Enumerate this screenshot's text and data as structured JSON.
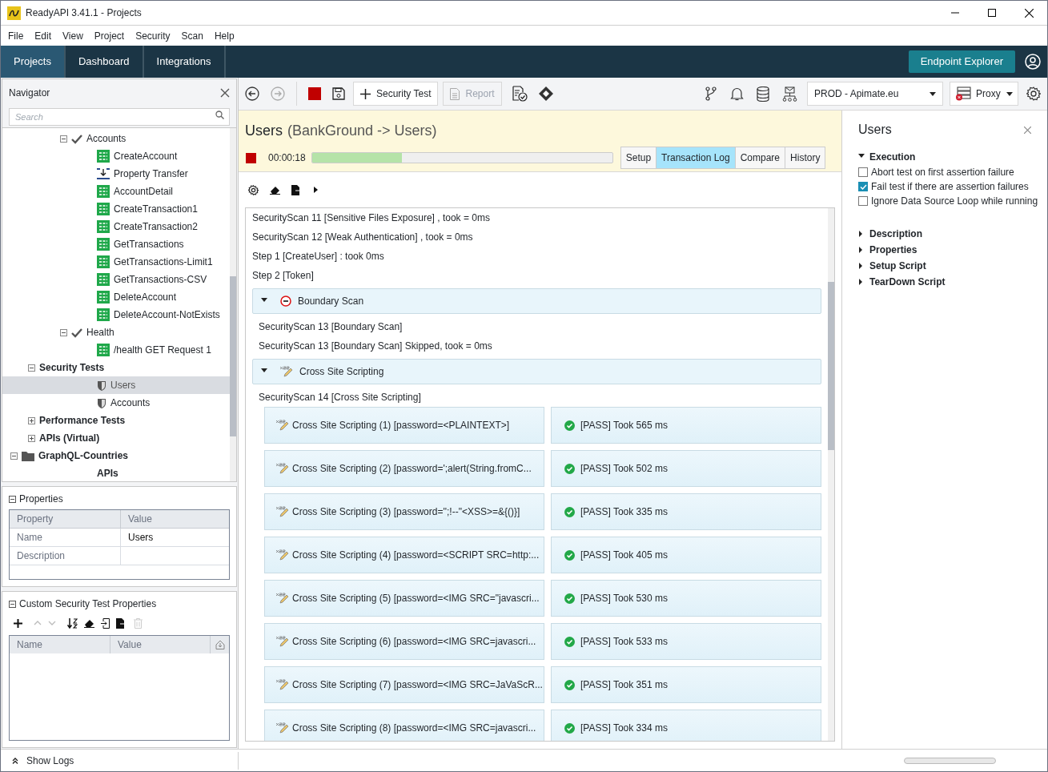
{
  "window": {
    "title": "ReadyAPI 3.41.1 - Projects"
  },
  "menu": [
    "File",
    "Edit",
    "View",
    "Project",
    "Security",
    "Scan",
    "Help"
  ],
  "nav_tabs": [
    {
      "label": "Projects",
      "selected": true
    },
    {
      "label": "Dashboard",
      "selected": false
    },
    {
      "label": "Integrations",
      "selected": false
    }
  ],
  "endpoint_button": "Endpoint Explorer",
  "navigator": {
    "title": "Navigator",
    "search_placeholder": "Search",
    "tree": [
      {
        "label": "Accounts",
        "kind": "check",
        "expanded": true,
        "selected": false,
        "children": [
          {
            "label": "CreateAccount",
            "kind": "rest",
            "selected": false
          },
          {
            "label": "Property Transfer",
            "kind": "transfer",
            "selected": false
          },
          {
            "label": "AccountDetail",
            "kind": "rest",
            "selected": false
          },
          {
            "label": "CreateTransaction1",
            "kind": "rest",
            "selected": false
          },
          {
            "label": "CreateTransaction2",
            "kind": "rest",
            "selected": false
          },
          {
            "label": "GetTransactions",
            "kind": "rest",
            "selected": false
          },
          {
            "label": "GetTransactions-Limit1",
            "kind": "rest",
            "selected": false
          },
          {
            "label": "GetTransactions-CSV",
            "kind": "rest",
            "selected": false
          },
          {
            "label": "DeleteAccount",
            "kind": "rest",
            "selected": false
          },
          {
            "label": "DeleteAccount-NotExists",
            "kind": "rest",
            "selected": false
          }
        ]
      },
      {
        "label": "Health",
        "kind": "check",
        "expanded": true,
        "selected": false,
        "children": [
          {
            "label": "/health GET Request 1",
            "kind": "rest",
            "selected": false
          }
        ]
      },
      {
        "label": "Security Tests",
        "kind": "section",
        "expanded": true,
        "selected": false,
        "children": [
          {
            "label": "Users",
            "kind": "shield",
            "selected": true
          },
          {
            "label": "Accounts",
            "kind": "shield",
            "selected": false
          }
        ]
      },
      {
        "label": "Performance Tests",
        "kind": "section",
        "expanded": false,
        "selected": false
      },
      {
        "label": "APIs (Virtual)",
        "kind": "section",
        "expanded": false,
        "selected": false
      },
      {
        "label": "GraphQL-Countries",
        "kind": "folder",
        "expanded": true,
        "selected": false,
        "children": [
          {
            "label": "APIs",
            "kind": "section",
            "selected": false
          }
        ]
      }
    ]
  },
  "properties": {
    "title": "Properties",
    "columns": [
      "Property",
      "Value"
    ],
    "rows": [
      [
        "Name",
        "Users"
      ],
      [
        "Description",
        ""
      ]
    ]
  },
  "custom_properties": {
    "title": "Custom Security Test Properties",
    "columns": [
      "Name",
      "Value"
    ]
  },
  "toolbar": {
    "security_test": "Security Test",
    "report": "Report",
    "environment": "PROD - Apimate.eu",
    "proxy": "Proxy"
  },
  "test": {
    "title": "Users",
    "path": "(BankGround -> Users)",
    "elapsed": "00:00:18",
    "level": 0.3,
    "tabs": [
      {
        "label": "Setup",
        "selected": false
      },
      {
        "label": "Transaction Log",
        "selected": true
      },
      {
        "label": "Compare",
        "selected": false
      },
      {
        "label": "History",
        "selected": false
      }
    ]
  },
  "log": [
    {
      "kind": "line",
      "text": "SecurityScan 11 [Sensitive Files Exposure] , took = 0ms"
    },
    {
      "kind": "line",
      "text": "SecurityScan 12 [Weak Authentication] , took = 0ms"
    },
    {
      "kind": "line",
      "text": "Step 1 [CreateUser] : took 0ms"
    },
    {
      "kind": "line",
      "text": "Step 2 [Token]"
    },
    {
      "kind": "boundary_group",
      "label": "Boundary Scan",
      "expanded": true,
      "entries": [
        {
          "kind": "line",
          "text": "SecurityScan 13 [Boundary Scan]"
        },
        {
          "kind": "line",
          "text": "SecurityScan 13 [Boundary Scan] Skipped, took = 0ms"
        }
      ]
    },
    {
      "kind": "xss_group",
      "label": "Cross Site Scripting",
      "expanded": true,
      "entries": [
        {
          "kind": "line",
          "text": "SecurityScan 14 [Cross Site Scripting]"
        },
        {
          "kind": "result",
          "request": "Cross Site Scripting (1) [password=<PLAINTEXT>]",
          "status": "[PASS] Took 565 ms",
          "passed": true
        },
        {
          "kind": "result",
          "request": "Cross Site Scripting (2) [password=';alert(String.fromC...",
          "status": "[PASS] Took 502 ms",
          "passed": true
        },
        {
          "kind": "result",
          "request": "Cross Site Scripting (3) [password='';!--\"<XSS>=&{()}]",
          "status": "[PASS] Took 335 ms",
          "passed": true
        },
        {
          "kind": "result",
          "request": "Cross Site Scripting (4) [password=<SCRIPT SRC=http:...",
          "status": "[PASS] Took 405 ms",
          "passed": true
        },
        {
          "kind": "result",
          "request": "Cross Site Scripting (5) [password=<IMG SRC=\"javascri...",
          "status": "[PASS] Took 530 ms",
          "passed": true
        },
        {
          "kind": "result",
          "request": "Cross Site Scripting (6) [password=<IMG SRC=javascri...",
          "status": "[PASS] Took 533 ms",
          "passed": true
        },
        {
          "kind": "result",
          "request": "Cross Site Scripting (7) [password=<IMG SRC=JaVaScR...",
          "status": "[PASS] Took 351 ms",
          "passed": true
        },
        {
          "kind": "result",
          "request": "Cross Site Scripting (8) [password=<IMG SRC=javascri...",
          "status": "[PASS] Took 334 ms",
          "passed": true
        }
      ]
    }
  ],
  "inspector": {
    "title": "Users",
    "sections": [
      {
        "label": "Execution",
        "expanded": true,
        "options": [
          {
            "label": "Abort test on first assertion failure",
            "checked": false
          },
          {
            "label": "Fail test if there are assertion failures",
            "checked": true
          },
          {
            "label": "Ignore Data Source Loop while running",
            "checked": false
          }
        ]
      },
      {
        "label": "Description",
        "expanded": false
      },
      {
        "label": "Properties",
        "expanded": false
      },
      {
        "label": "Setup Script",
        "expanded": false
      },
      {
        "label": "TearDown Script",
        "expanded": false
      }
    ]
  },
  "status_bar": {
    "show_logs": "Show Logs"
  }
}
